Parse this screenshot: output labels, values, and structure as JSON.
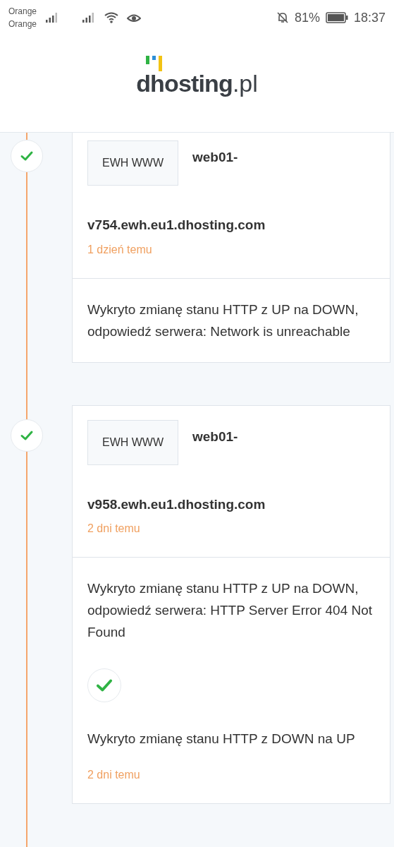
{
  "status_bar": {
    "carriers": [
      "Orange",
      "Orange"
    ],
    "battery_percent": "81%",
    "time": "18:37"
  },
  "logo": {
    "name": "dhosting",
    "tld": ".pl"
  },
  "timeline": [
    {
      "badge": "EWH WWW",
      "host_prefix": "web01-",
      "host": "v754.ewh.eu1.dhosting.com",
      "time": "1 dzień temu",
      "events": [
        {
          "text": "Wykryto zmianę stanu HTTP z UP na DOWN, odpowiedź serwera: Network is unreachable"
        }
      ]
    },
    {
      "badge": "EWH WWW",
      "host_prefix": "web01-",
      "host": "v958.ewh.eu1.dhosting.com",
      "time": "2 dni temu",
      "events": [
        {
          "text": "Wykryto zmianę stanu HTTP z UP na DOWN, odpowiedź serwera: HTTP Server Error 404 Not Found"
        },
        {
          "text": "Wykryto zmianę stanu HTTP z DOWN na UP",
          "time": "2 dni temu"
        }
      ]
    }
  ]
}
